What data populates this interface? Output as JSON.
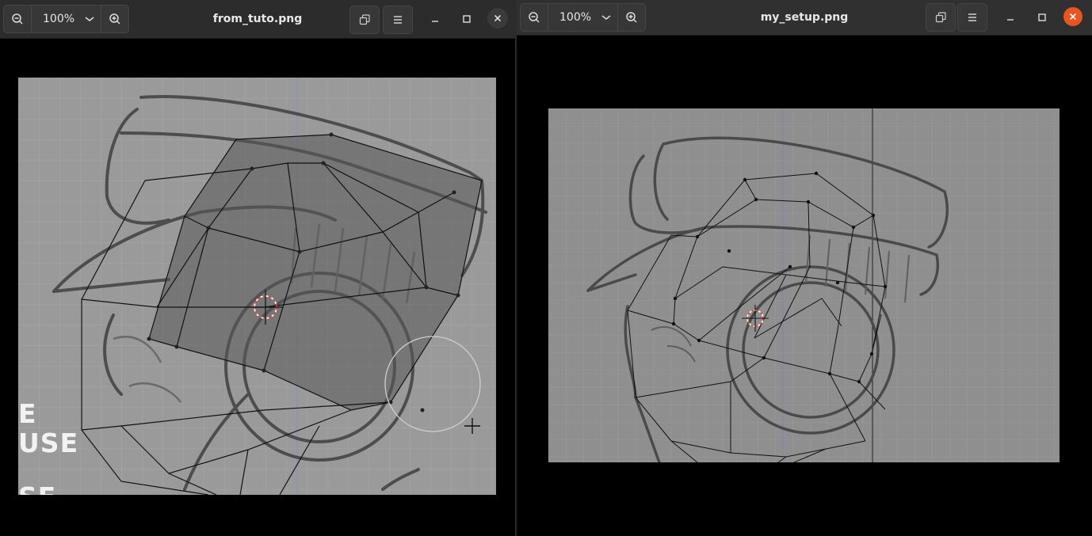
{
  "windows": {
    "left": {
      "title": "from_tuto.png",
      "zoom": "100%"
    },
    "right": {
      "title": "my_setup.png",
      "zoom": "100%"
    }
  },
  "left_overlay_text": {
    "line1": "E",
    "line2": "USE",
    "line3": "SE"
  },
  "colors": {
    "titlebar_bg": "#2c2c2c",
    "close_left": "#3a3a3a",
    "close_right": "#e95420",
    "viewport_left": "#9a9a9a",
    "viewport_right": "#8f8f8f"
  },
  "icons": {
    "zoom_out": "zoom-out-icon",
    "zoom_in": "zoom-in-icon",
    "zoom_menu": "chevron-down-icon",
    "restore": "restore-window-icon",
    "menu": "hamburger-menu-icon",
    "minimize": "minimize-icon",
    "maximize": "maximize-icon",
    "close": "close-icon"
  }
}
